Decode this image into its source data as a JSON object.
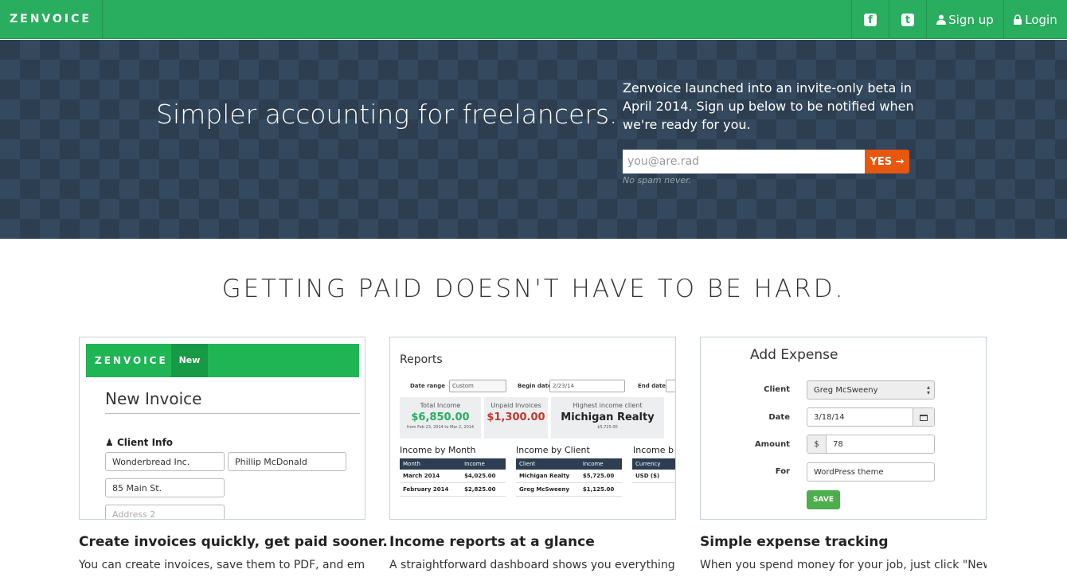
{
  "nav": {
    "brand": "ZENVOICE",
    "facebook_glyph": "f",
    "twitter_glyph": "t",
    "signup": "Sign up",
    "login": "Login",
    "icons": [
      "facebook-icon",
      "twitter-icon",
      "user-icon",
      "lock-icon"
    ]
  },
  "hero": {
    "tagline": "Simpler accounting for freelancers.",
    "blurb": "Zenvoice launched into an invite-only beta in April 2014. Sign up below to be notified when we're ready for you.",
    "email_placeholder": "you@are.rad",
    "submit": "YES →",
    "note": "No spam never."
  },
  "section": {
    "heading": "GETTING PAID DOESN'T HAVE TO BE HARD."
  },
  "features": [
    {
      "title": "Create invoices quickly, get paid sooner.",
      "desc": "You can create invoices, save them to PDF, and email",
      "mock": {
        "brand": "ZENVOICE",
        "nav_item": "New",
        "heading": "New Invoice",
        "section_label": "Client Info",
        "fields": [
          "Wonderbread Inc.",
          "Phillip McDonald",
          "85 Main St.",
          "Address 2"
        ]
      }
    },
    {
      "title": "Income reports at a glance",
      "desc": "A straightforward dashboard shows you everything",
      "mock": {
        "heading": "Reports",
        "date_range_label": "Date range",
        "date_range_value": "Custom",
        "begin_label": "Begin date",
        "begin_value": "2/23/14",
        "end_label": "End date",
        "boxes": [
          {
            "label": "Total Income",
            "value": "$6,850.00",
            "note": "from Feb 23, 2014 to Mar 2, 2014"
          },
          {
            "label": "Unpaid Invoices",
            "value": "$1,300.00",
            "note": ""
          },
          {
            "label": "Highest income client",
            "value": "Michigan Realty",
            "note": "$5,725.00"
          }
        ],
        "by_month": {
          "title": "Income by Month",
          "headers": [
            "Month",
            "Income"
          ],
          "rows": [
            [
              "March 2014",
              "$4,025.00"
            ],
            [
              "February 2014",
              "$2,825.00"
            ]
          ]
        },
        "by_client": {
          "title": "Income by Client",
          "headers": [
            "Client",
            "Income"
          ],
          "rows": [
            [
              "Michigan Realty",
              "$5,725.00"
            ],
            [
              "Greg McSweeny",
              "$1,125.00"
            ]
          ]
        },
        "by_currency": {
          "title": "Income b",
          "headers": [
            "Currency"
          ],
          "rows": [
            [
              "USD ($)"
            ]
          ]
        }
      }
    },
    {
      "title": "Simple expense tracking",
      "desc": "When you spend money for your job, just click \"New",
      "mock": {
        "heading": "Add Expense",
        "client_label": "Client",
        "client_value": "Greg McSweeny",
        "date_label": "Date",
        "date_value": "3/18/14",
        "amount_label": "Amount",
        "currency_symbol": "$",
        "amount_value": "78",
        "for_label": "For",
        "for_value": "WordPress theme",
        "save": "SAVE"
      }
    }
  ],
  "colors": {
    "nav": "#29ad5e",
    "hero": "#2c3e50",
    "accent": "#e8570e",
    "save": "#4cae4c"
  }
}
